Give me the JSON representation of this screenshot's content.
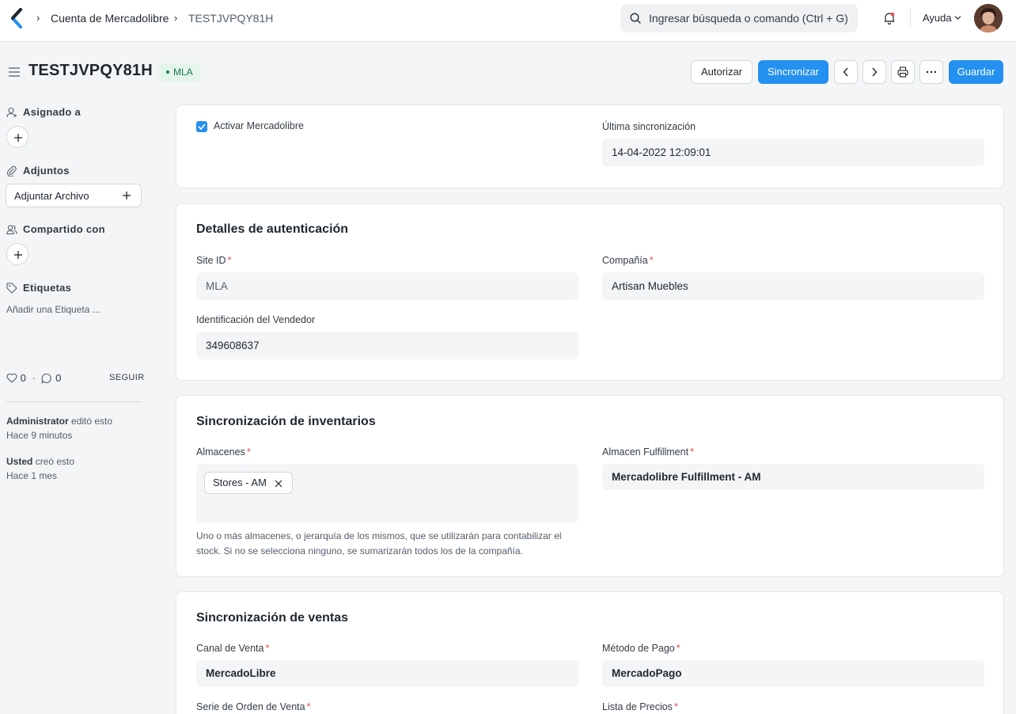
{
  "navbar": {
    "breadcrumbs": [
      "Cuenta de Mercadolibre",
      "TESTJVPQY81H"
    ],
    "search_placeholder": "Ingresar búsqueda o comando (Ctrl + G)",
    "help_label": "Ayuda"
  },
  "header": {
    "title": "TESTJVPQY81H",
    "status_badge": "MLA",
    "buttons": {
      "authorize": "Autorizar",
      "sync": "Sincronizar",
      "save": "Guardar"
    }
  },
  "sidebar": {
    "assigned_to": "Asignado a",
    "attachments": "Adjuntos",
    "attach_file": "Adjuntar Archivo",
    "shared_with": "Compartido con",
    "tags": "Etiquetas",
    "add_tag": "Añadir una Etiqueta ...",
    "likes": "0",
    "comments": "0",
    "separator": "·",
    "follow": "SEGUIR",
    "activity": [
      {
        "user": "Administrator",
        "action": "editó esto",
        "time": "Hace 9 minutos"
      },
      {
        "user": "Usted",
        "action": "creó esto",
        "time": "Hace 1 mes"
      }
    ]
  },
  "form": {
    "enable_label": "Activar Mercadolibre",
    "enable_checked": true,
    "last_sync_label": "Última sincronización",
    "last_sync_value": "14-04-2022 12:09:01",
    "auth": {
      "title": "Detalles de autenticación",
      "site_id_label": "Site ID",
      "site_id_value": "MLA",
      "company_label": "Compañía",
      "company_value": "Artisan Muebles",
      "seller_id_label": "Identificación del Vendedor",
      "seller_id_value": "349608637"
    },
    "inventory": {
      "title": "Sincronización de inventarios",
      "warehouses_label": "Almacenes",
      "warehouses": [
        "Stores - AM"
      ],
      "warehouses_help": "Uno o más almacenes, o jerarquía de los mismos, que se utilizarán para contabilizar el stock. Si no se selecciona ninguno, se sumarizarán todos los de la compañía.",
      "fulfillment_label": "Almacen Fulfillment",
      "fulfillment_value": "Mercadolibre Fulfillment - AM"
    },
    "sales": {
      "title": "Sincronización de ventas",
      "channel_label": "Canal de Venta",
      "channel_value": "MercadoLibre",
      "payment_label": "Método de Pago",
      "payment_value": "MercadoPago",
      "series_label": "Serie de Orden de Venta",
      "price_list_label": "Lista de Precios"
    },
    "required_mark": "*"
  },
  "colors": {
    "primary": "#2490ef",
    "badge_bg": "#e4f5e9",
    "badge_text": "#16794c",
    "required": "#e24c4c"
  }
}
